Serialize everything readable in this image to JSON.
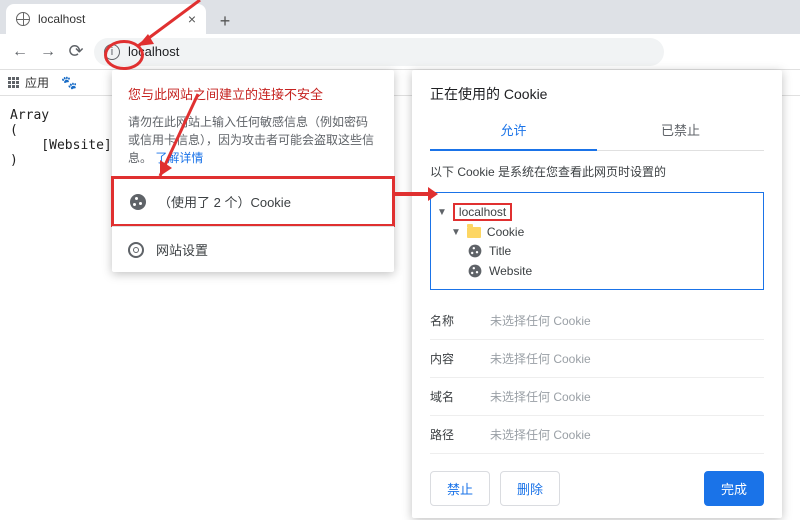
{
  "tab": {
    "title": "localhost",
    "close": "×",
    "new": "+"
  },
  "nav": {
    "back": "←",
    "fwd": "→",
    "reload": "⟳"
  },
  "address": {
    "url": "localhost",
    "info": "ⓘ"
  },
  "bookmarks": {
    "apps_label": "应用",
    "baidu_icon": "🐾"
  },
  "page_content": "Array\n(\n    [Website] =\n)",
  "popup_security": {
    "title": "您与此网站之间建立的连接不安全",
    "body_prefix": "请勿在此网站上输入任何敏感信息（例如密码或信用卡信息），因为攻击者可能会盗取这些信息。",
    "learn_more": "了解详情",
    "cookie_row": "（使用了 2 个）Cookie",
    "site_settings": "网站设置"
  },
  "popup_cookies": {
    "title": "正在使用的 Cookie",
    "tab_allow": "允许",
    "tab_block": "已禁止",
    "description": "以下 Cookie 是系统在您查看此网页时设置的",
    "tree": {
      "host": "localhost",
      "folder": "Cookie",
      "items": [
        "Title",
        "Website"
      ]
    },
    "details": {
      "name_label": "名称",
      "name_value": "未选择任何 Cookie",
      "content_label": "内容",
      "content_value": "未选择任何 Cookie",
      "domain_label": "域名",
      "domain_value": "未选择任何 Cookie",
      "path_label": "路径",
      "path_value": "未选择任何 Cookie"
    },
    "actions": {
      "block": "禁止",
      "delete": "删除",
      "done": "完成"
    }
  }
}
